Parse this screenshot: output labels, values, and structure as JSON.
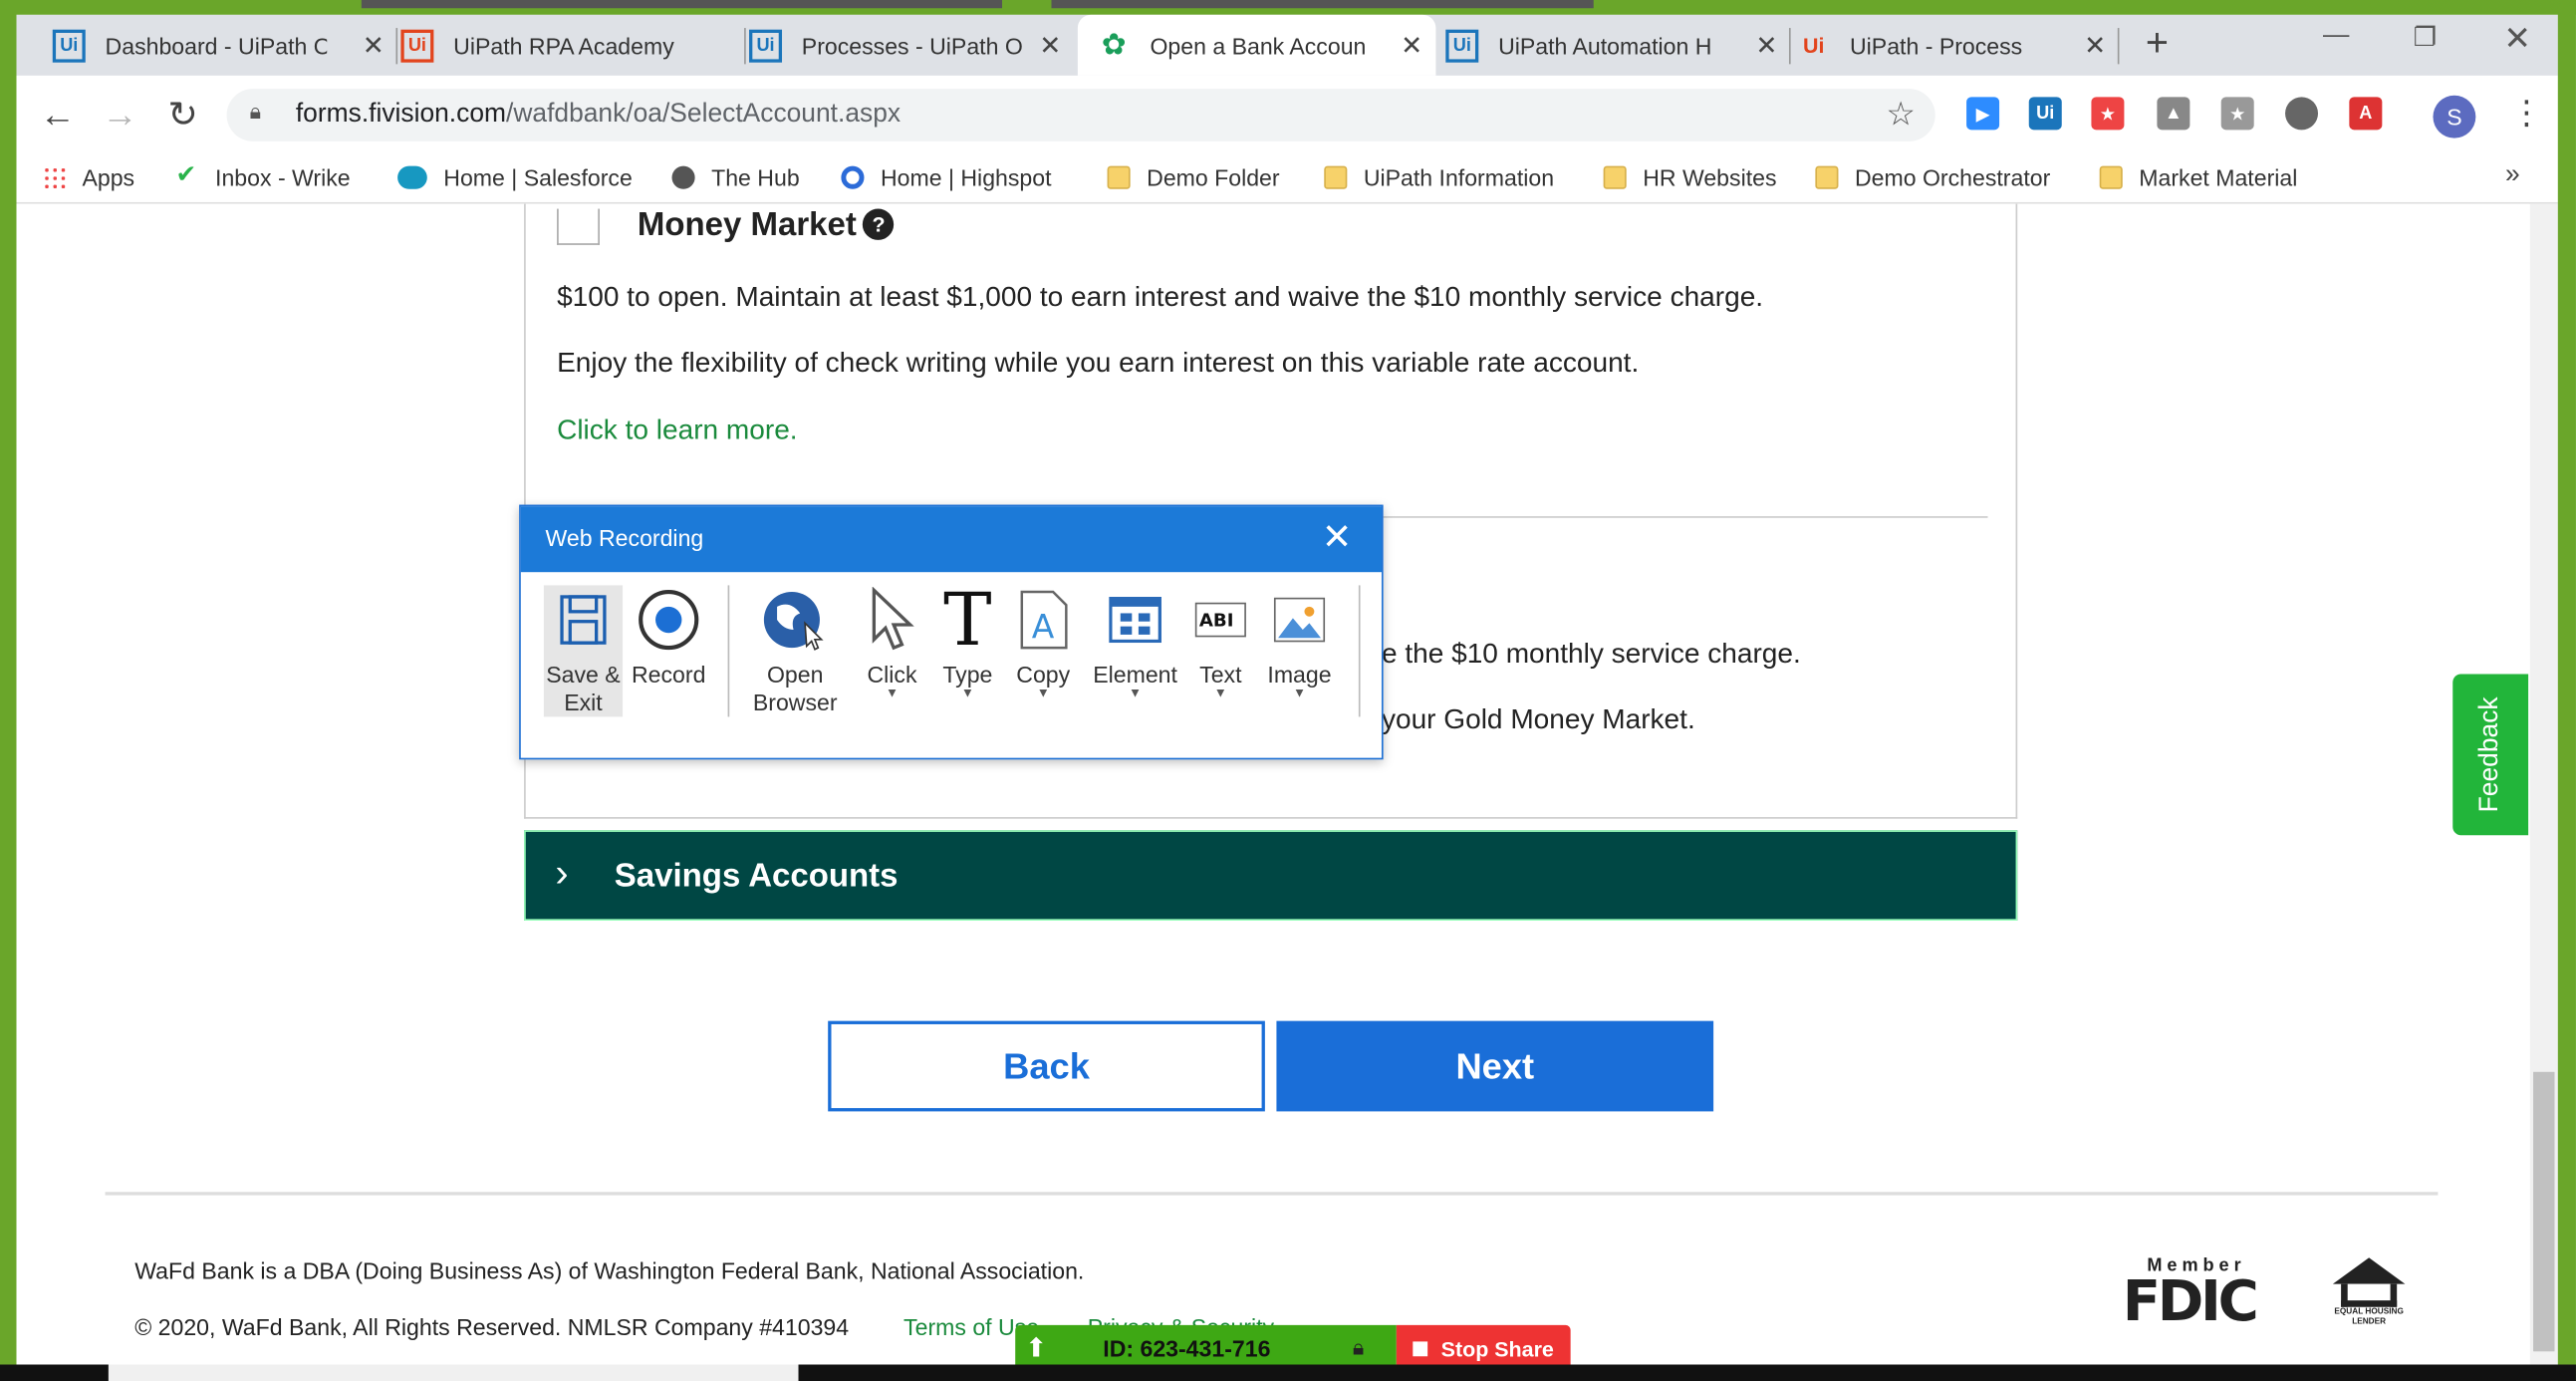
{
  "browser": {
    "tabs": [
      {
        "label": "Dashboard - UiPath O",
        "icon": "Ui",
        "icon_color": "#1b75bb"
      },
      {
        "label": "UiPath RPA Academy",
        "icon": "Ui",
        "icon_color": "#e2441d"
      },
      {
        "label": "Processes - UiPath O",
        "icon": "Ui",
        "icon_color": "#1b75bb"
      },
      {
        "label": "Open a Bank Accoun",
        "icon": "wafd-icon",
        "icon_color": "#1a9e5a"
      },
      {
        "label": "UiPath Automation H",
        "icon": "Ui",
        "icon_color": "#1b75bb"
      },
      {
        "label": "UiPath - Process",
        "icon": "Ui",
        "icon_color": "#e2441d"
      }
    ],
    "url_host": "forms.fivision.com",
    "url_path": "/wafdbank/oa/SelectAccount.aspx",
    "avatar_letter": "S",
    "bookmarks": [
      {
        "label": "Apps",
        "icon": "apps-grid-icon"
      },
      {
        "label": "Inbox - Wrike",
        "icon": "wrike-check-icon"
      },
      {
        "label": "Home | Salesforce",
        "icon": "salesforce-cloud-icon"
      },
      {
        "label": "The Hub",
        "icon": "globe-icon"
      },
      {
        "label": "Home | Highspot",
        "icon": "highspot-icon"
      },
      {
        "label": "Demo Folder",
        "icon": "folder-icon"
      },
      {
        "label": "UiPath Information",
        "icon": "folder-icon"
      },
      {
        "label": "HR Websites",
        "icon": "folder-icon"
      },
      {
        "label": "Demo Orchestrator",
        "icon": "folder-icon"
      },
      {
        "label": "Market Material",
        "icon": "folder-icon"
      }
    ]
  },
  "page": {
    "account": {
      "title": "Money Market",
      "line1": "$100 to open. Maintain at least $1,000 to earn interest and waive the $10 monthly service charge.",
      "line2": "Enjoy the flexibility of check writing while you earn interest on this variable rate account.",
      "learn_more": "Click to learn more."
    },
    "partial_account": {
      "line1_tail": "e the $10 monthly service charge.",
      "line2_tail": "your Gold Money Market."
    },
    "savings_title": "Savings Accounts",
    "back_label": "Back",
    "next_label": "Next",
    "footer_line1": "WaFd Bank is a DBA (Doing Business As) of Washington Federal Bank, National Association.",
    "footer_line2": "© 2020, WaFd Bank, All Rights Reserved. NMLSR Company #410394",
    "terms_label": "Terms of Use",
    "privacy_label": "Privacy & Security",
    "fdic_member": "Member",
    "fdic_text": "FDIC",
    "ehl_label": "EQUAL HOUSING LENDER",
    "feedback_label": "Feedback"
  },
  "web_recording": {
    "title": "Web Recording",
    "buttons": [
      {
        "label": "Save & Exit",
        "icon": "save-icon"
      },
      {
        "label": "Record",
        "icon": "record-icon"
      },
      {
        "label": "Open Browser",
        "icon": "open-browser-icon"
      },
      {
        "label": "Click",
        "icon": "cursor-icon"
      },
      {
        "label": "Type",
        "icon": "type-icon"
      },
      {
        "label": "Copy",
        "icon": "copy-icon"
      },
      {
        "label": "Element",
        "icon": "element-icon"
      },
      {
        "label": "Text",
        "icon": "text-icon"
      },
      {
        "label": "Image",
        "icon": "image-icon"
      }
    ]
  },
  "share_bar": {
    "id_text": "ID: 623-431-716",
    "stop_label": "Stop Share"
  },
  "colors": {
    "savings_bg": "#004744",
    "primary_blue": "#1a6ed8",
    "link_green": "#1a8a3c",
    "feedback_green": "#22b53a",
    "dialog_blue": "#1c7ad8"
  }
}
